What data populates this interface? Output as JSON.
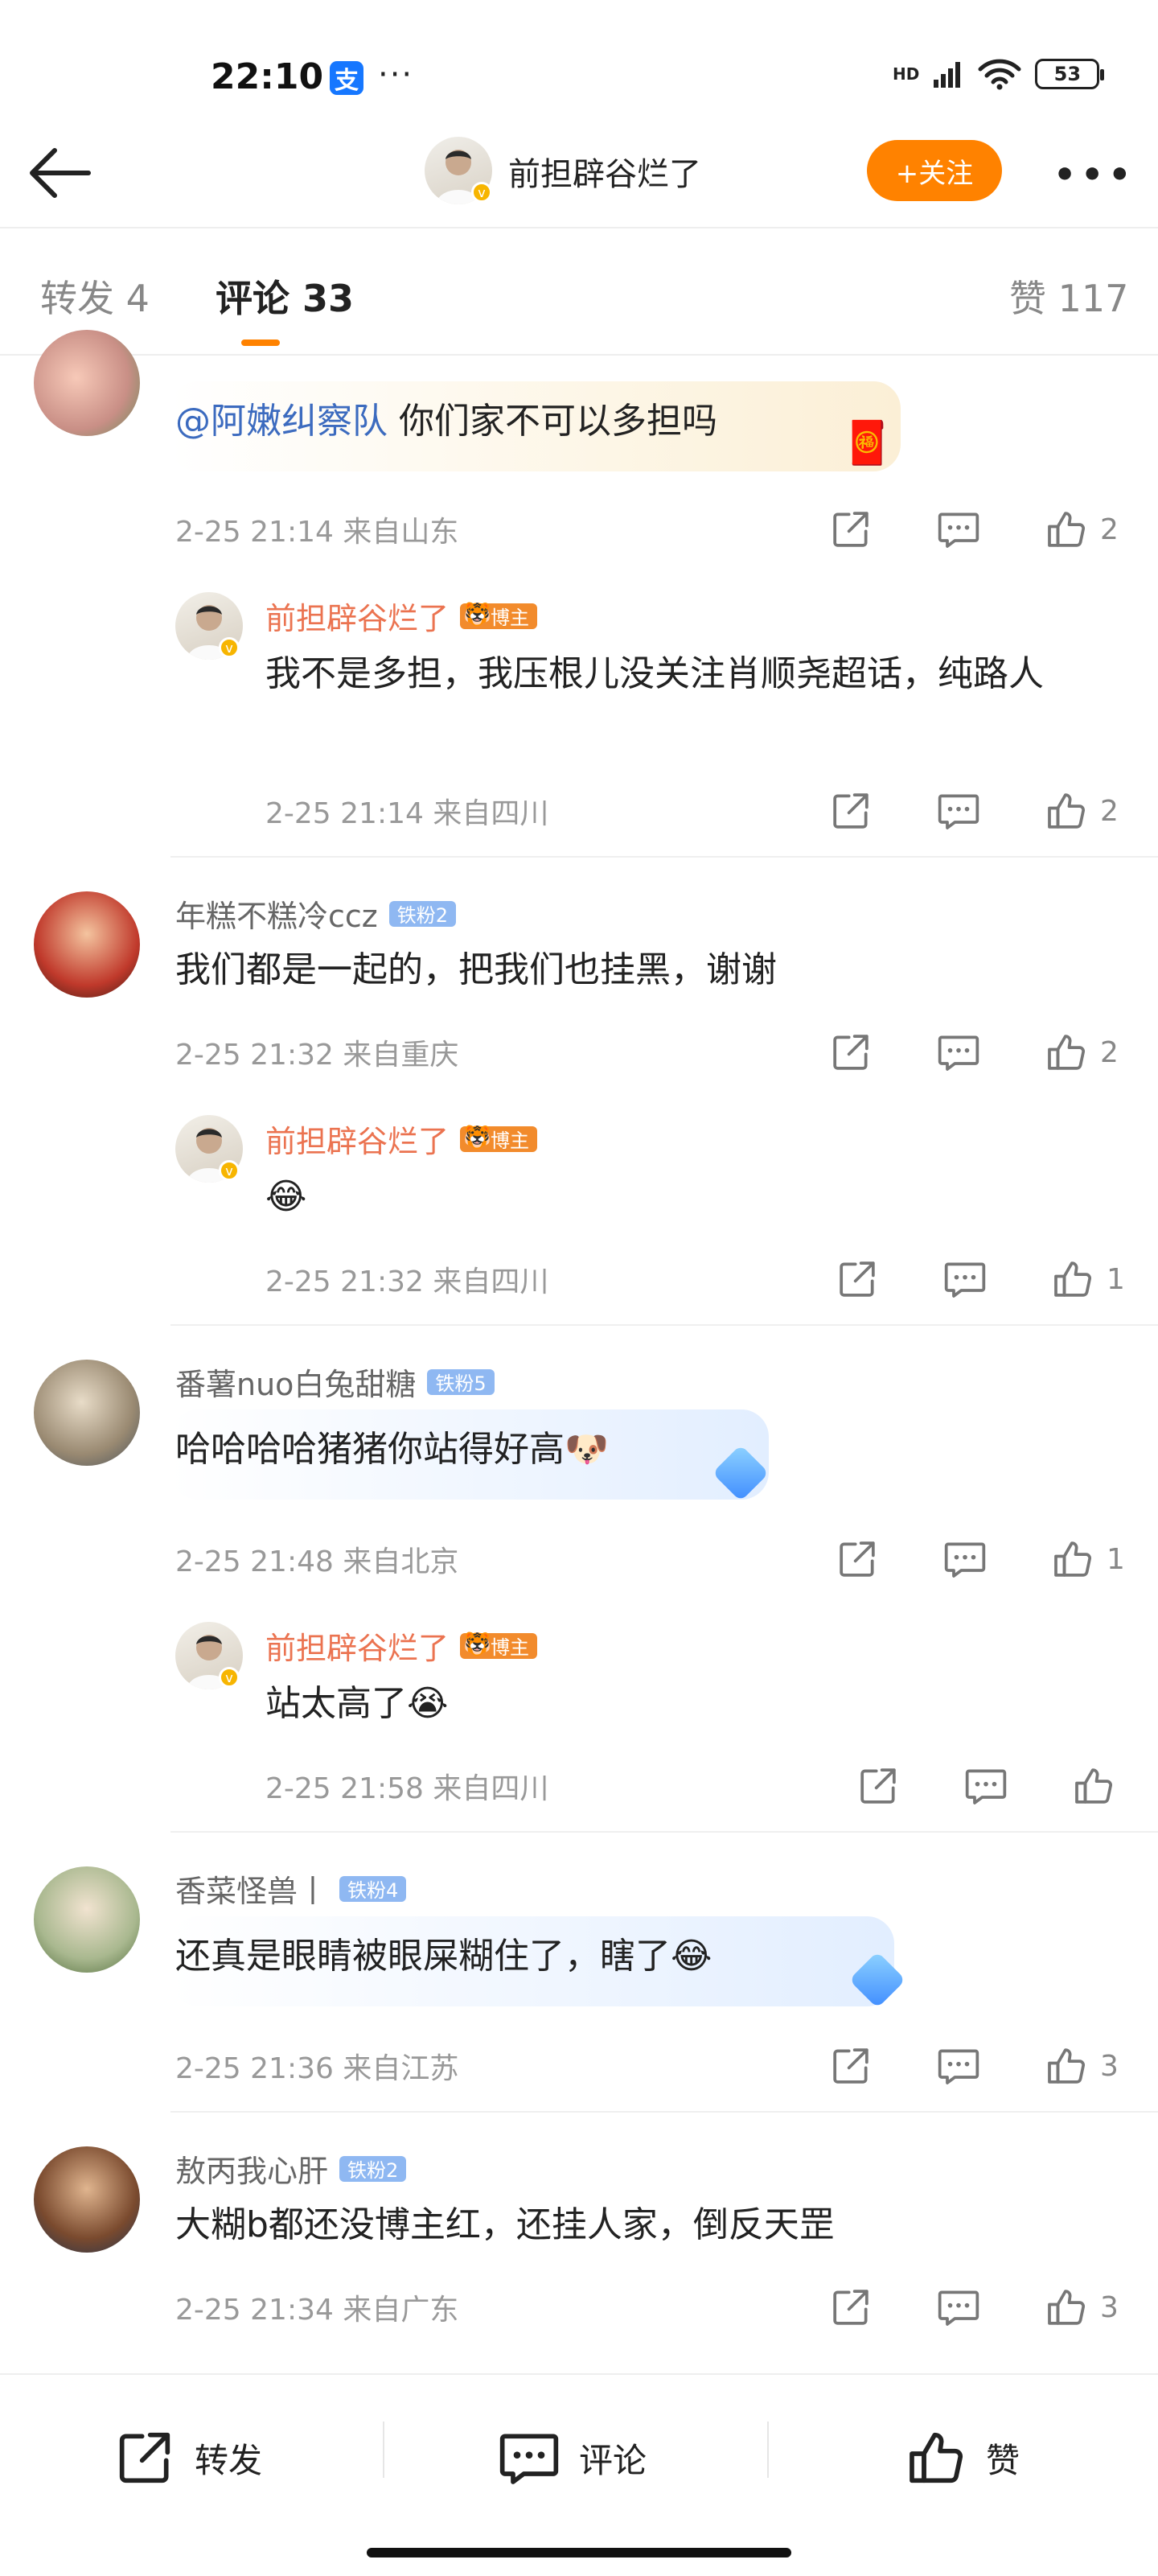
{
  "status_bar": {
    "time": "22:10",
    "alipay": "支",
    "dots": "···",
    "network": "HD",
    "battery": "53"
  },
  "header": {
    "title": "前担辟谷烂了",
    "follow": "+关注",
    "more": "•••"
  },
  "tabs": [
    {
      "label": "转发 4"
    },
    {
      "label": "评论 33"
    },
    {
      "label": "赞 117"
    }
  ],
  "comments": [
    {
      "text_mention": "@阿嫩纠察队",
      "text": "你们家不可以多担吗",
      "meta": "2-25 21:14  来自山东",
      "likes": "2",
      "reply": {
        "user": "前担辟谷烂了",
        "badge": "博主",
        "text": "我不是多担，我压根儿没关注肖顺尧超话，纯路人",
        "meta": "2-25 21:14  来自四川",
        "likes": "2"
      }
    },
    {
      "user": "年糕不糕冷ccz",
      "badge": "铁粉2",
      "text": "我们都是一起的，把我们也挂黑，谢谢",
      "meta": "2-25 21:32  来自重庆",
      "likes": "2",
      "reply": {
        "user": "前担辟谷烂了",
        "badge": "博主",
        "text": "😂",
        "meta": "2-25 21:32  来自四川",
        "likes": "1"
      }
    },
    {
      "user": "番薯nuo白兔甜糖",
      "badge": "铁粉5",
      "text": "哈哈哈哈猪猪你站得好高🐶",
      "meta": "2-25 21:48  来自北京",
      "likes": "1",
      "reply": {
        "user": "前担辟谷烂了",
        "badge": "博主",
        "text": "站太高了😭",
        "meta": "2-25 21:58  来自四川",
        "likes": ""
      }
    },
    {
      "user": "香菜怪兽丨",
      "badge": "铁粉4",
      "text": "还真是眼睛被眼屎糊住了，瞎了😂",
      "meta": "2-25 21:36  来自江苏",
      "likes": "3"
    },
    {
      "user": "敖丙我心肝",
      "badge": "铁粉2",
      "text": "大糊b都还没博主红，还挂人家，倒反天罡",
      "meta": "2-25 21:34  来自广东",
      "likes": "3"
    }
  ],
  "bottom_bar": {
    "repost": "转发",
    "comment": "评论",
    "like": "赞"
  },
  "colors": {
    "accent": "#ff8200",
    "op_name": "#eb7350",
    "mention": "#3c6bbf",
    "fan_badge": "#8fb8f2"
  }
}
